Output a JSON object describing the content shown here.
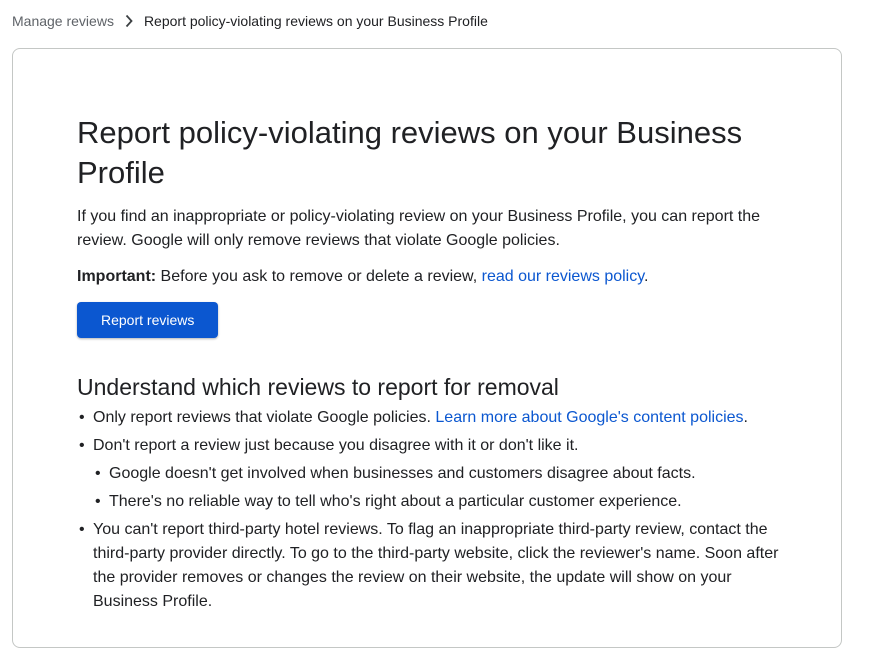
{
  "breadcrumb": {
    "parent": "Manage reviews",
    "current": "Report policy-violating reviews on your Business Profile"
  },
  "article": {
    "title": "Report policy-violating reviews on your Business Profile",
    "intro": "If you find an inappropriate or policy-violating review on your Business Profile, you can report the review. Google will only remove reviews that violate Google policies.",
    "important_label": "Important:",
    "important_text": " Before you ask to remove or delete a review, ",
    "important_link": "read our reviews policy",
    "important_end": ".",
    "button_label": "Report reviews",
    "section_heading": "Understand which reviews to report for removal",
    "bullets": {
      "b1_text": "Only report reviews that violate Google policies. ",
      "b1_link": "Learn more about Google's content policies",
      "b1_end": ".",
      "b2_text": "Don't report a review just because you disagree with it or don't like it.",
      "b2_sub1": "Google doesn't get involved when businesses and customers disagree about facts.",
      "b2_sub2": "There's no reliable way to tell who's right about a particular customer experience.",
      "b3_text": "You can't report third-party hotel reviews. To flag an inappropriate third-party review, contact the third-party provider directly. To go to the third-party website, click the reviewer's name. Soon after the provider removes or changes the review on their website, the update will show on your Business Profile."
    }
  },
  "colors": {
    "link": "#0b57d0",
    "button_bg": "#0b57d0",
    "text": "#202124",
    "breadcrumb_parent": "#5f6368",
    "card_border": "#c4c7c5"
  },
  "icons": {
    "breadcrumb_separator": "chevron-right-icon"
  }
}
